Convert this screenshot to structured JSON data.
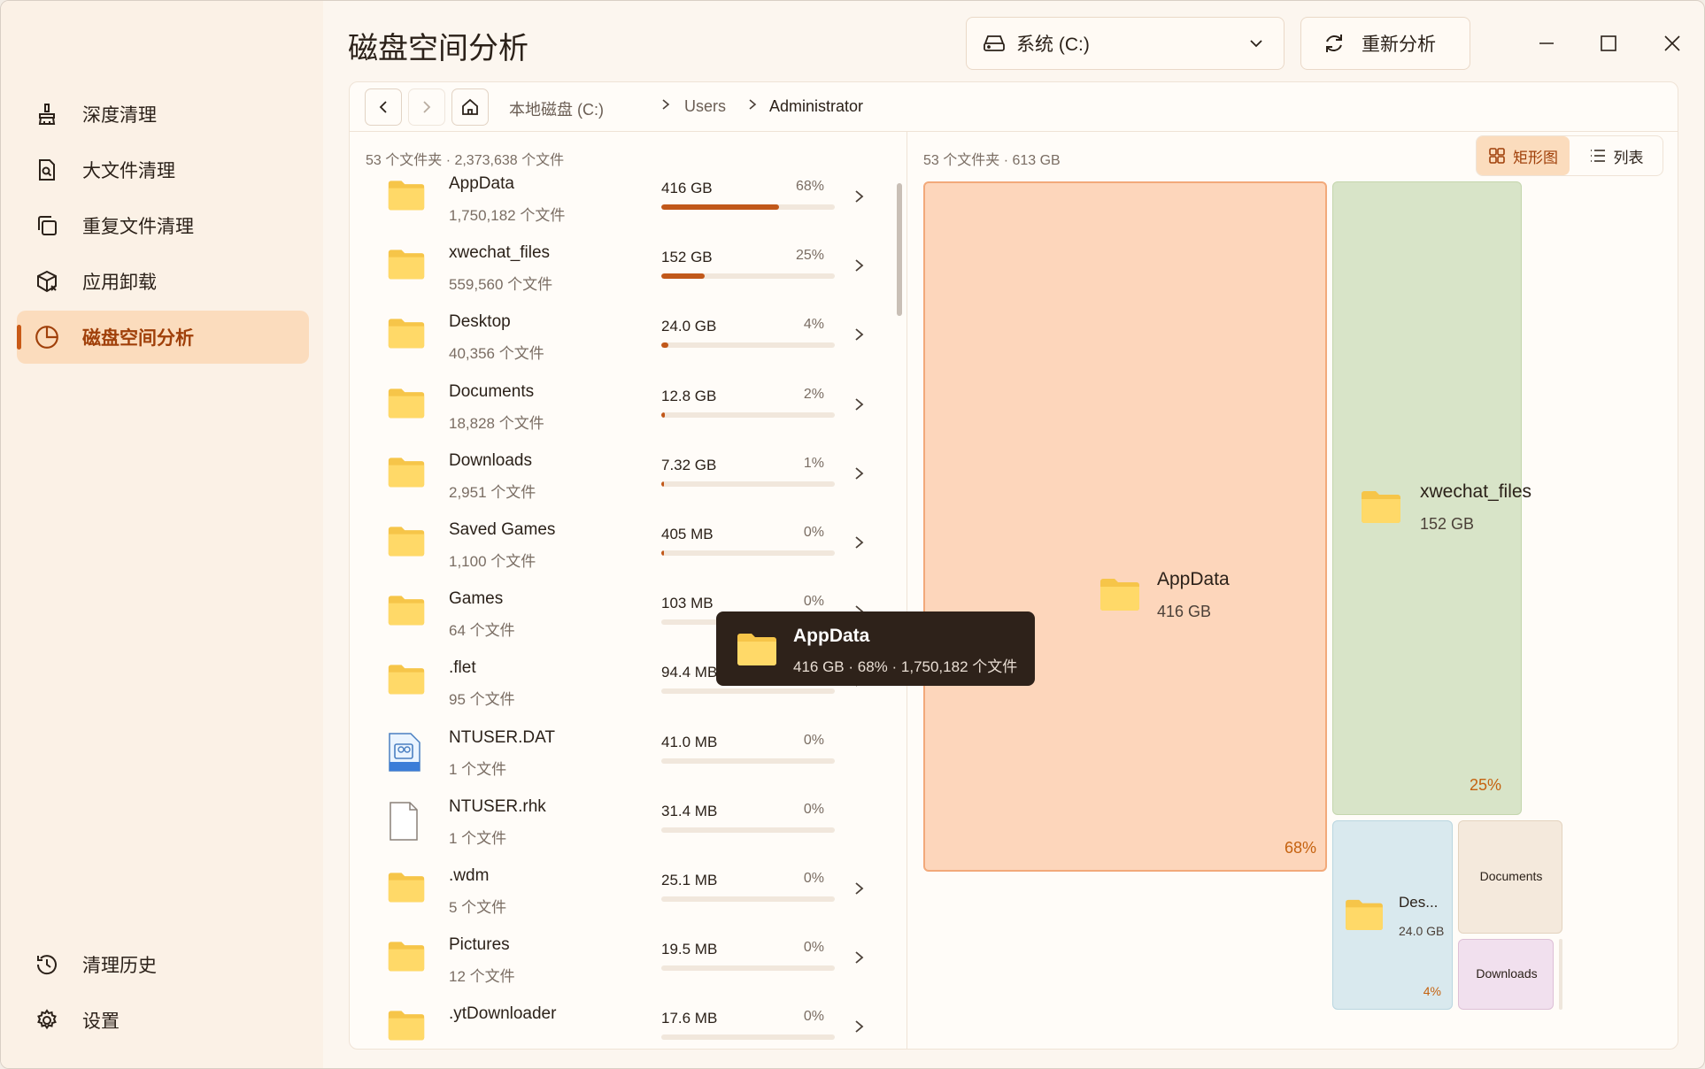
{
  "sidebar": {
    "items": [
      {
        "label": "深度清理",
        "icon": "broom-icon"
      },
      {
        "label": "大文件清理",
        "icon": "file-search-icon"
      },
      {
        "label": "重复文件清理",
        "icon": "copy-icon"
      },
      {
        "label": "应用卸载",
        "icon": "package-remove-icon"
      },
      {
        "label": "磁盘空间分析",
        "icon": "pie-chart-icon",
        "active": true
      }
    ],
    "bottom": [
      {
        "label": "清理历史",
        "icon": "history-icon"
      },
      {
        "label": "设置",
        "icon": "gear-icon"
      }
    ]
  },
  "header": {
    "title": "磁盘空间分析",
    "drive": "系统 (C:)",
    "rescan": "重新分析"
  },
  "breadcrumb": [
    "本地磁盘 (C:)",
    "Users",
    "Administrator"
  ],
  "list": {
    "summary": "53 个文件夹 · 2,373,638 个文件",
    "rows": [
      {
        "name": "AppData",
        "count": "1,750,182 个文件",
        "size": "416 GB",
        "pct": "68%",
        "fill": 0.68,
        "type": "folder",
        "expandable": true
      },
      {
        "name": "xwechat_files",
        "count": "559,560 个文件",
        "size": "152 GB",
        "pct": "25%",
        "fill": 0.25,
        "type": "folder",
        "expandable": true
      },
      {
        "name": "Desktop",
        "count": "40,356 个文件",
        "size": "24.0 GB",
        "pct": "4%",
        "fill": 0.04,
        "type": "folder",
        "expandable": true
      },
      {
        "name": "Documents",
        "count": "18,828 个文件",
        "size": "12.8 GB",
        "pct": "2%",
        "fill": 0.02,
        "type": "folder",
        "expandable": true
      },
      {
        "name": "Downloads",
        "count": "2,951 个文件",
        "size": "7.32 GB",
        "pct": "1%",
        "fill": 0.012,
        "type": "folder",
        "expandable": true
      },
      {
        "name": "Saved Games",
        "count": "1,100 个文件",
        "size": "405 MB",
        "pct": "0%",
        "fill": 0.001,
        "type": "folder",
        "expandable": true
      },
      {
        "name": "Games",
        "count": "64 个文件",
        "size": "103 MB",
        "pct": "0%",
        "fill": 0.0,
        "type": "folder",
        "expandable": true
      },
      {
        "name": ".flet",
        "count": "95 个文件",
        "size": "94.4 MB",
        "pct": "0%",
        "fill": 0.0,
        "type": "folder",
        "expandable": true
      },
      {
        "name": "NTUSER.DAT",
        "count": "1 个文件",
        "size": "41.0 MB",
        "pct": "0%",
        "fill": 0.0,
        "type": "video",
        "expandable": false
      },
      {
        "name": "NTUSER.rhk",
        "count": "1 个文件",
        "size": "31.4 MB",
        "pct": "0%",
        "fill": 0.0,
        "type": "file",
        "expandable": false
      },
      {
        "name": ".wdm",
        "count": "5 个文件",
        "size": "25.1 MB",
        "pct": "0%",
        "fill": 0.0,
        "type": "folder",
        "expandable": true
      },
      {
        "name": "Pictures",
        "count": "12 个文件",
        "size": "19.5 MB",
        "pct": "0%",
        "fill": 0.0,
        "type": "folder",
        "expandable": true
      },
      {
        "name": ".ytDownloader",
        "count": "",
        "size": "17.6 MB",
        "pct": "0%",
        "fill": 0.0,
        "type": "folder",
        "expandable": true
      }
    ]
  },
  "treemap": {
    "summary": "53 个文件夹 · 613 GB",
    "view_treemap": "矩形图",
    "view_list": "列表",
    "tiles": {
      "appdata": {
        "name": "AppData",
        "size": "416 GB",
        "pct": "68%",
        "color": "#fdd6bb"
      },
      "xwechat": {
        "name": "xwechat_files",
        "size": "152 GB",
        "pct": "25%",
        "color": "#d8e4c8"
      },
      "desktop": {
        "name": "Des...",
        "size": "24.0 GB",
        "pct": "4%",
        "color": "#d9e9ee"
      },
      "documents": {
        "name": "Documents",
        "color": "#f4e9dc"
      },
      "downloads": {
        "name": "Downloads",
        "color": "#f1e0ee"
      }
    }
  },
  "tooltip": {
    "name": "AppData",
    "detail": "416 GB · 68% · 1,750,182 个文件"
  },
  "colors": {
    "accent": "#c95a17",
    "active_bg": "#fbdcbd",
    "tooltip_bg": "#2e221a"
  }
}
